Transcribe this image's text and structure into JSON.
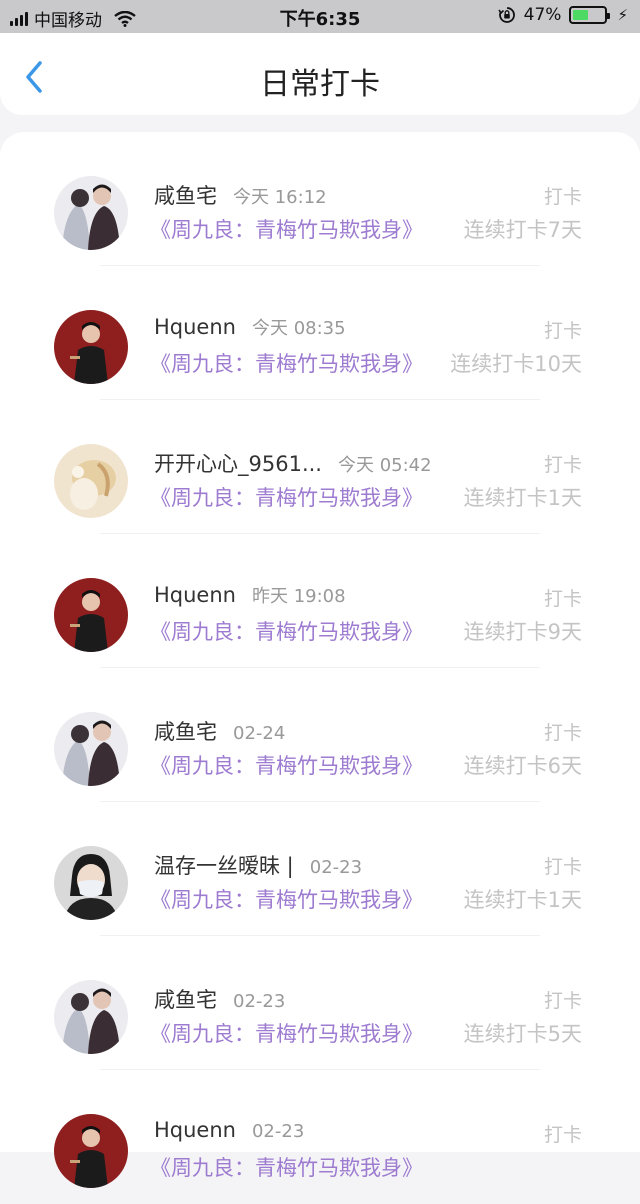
{
  "status_bar": {
    "carrier": "中国移动",
    "time": "下午6:35",
    "battery": "47%",
    "battery_level": 0.47
  },
  "nav": {
    "title": "日常打卡"
  },
  "entries": [
    {
      "name": "咸鱼宅",
      "time": "今天 16:12",
      "book": "《周九良：青梅竹马欺我身》",
      "label": "打卡",
      "streak": "连续打卡7天",
      "avatar": "avatar-couple"
    },
    {
      "name": "Hquenn",
      "time": "今天 08:35",
      "book": "《周九良：青梅竹马欺我身》",
      "label": "打卡",
      "streak": "连续打卡10天",
      "avatar": "avatar-red"
    },
    {
      "name": "开开心心_9561...",
      "time": "今天 05:42",
      "book": "《周九良：青梅竹马欺我身》",
      "label": "打卡",
      "streak": "连续打卡1天",
      "avatar": "avatar-beige"
    },
    {
      "name": "Hquenn",
      "time": "昨天 19:08",
      "book": "《周九良：青梅竹马欺我身》",
      "label": "打卡",
      "streak": "连续打卡9天",
      "avatar": "avatar-red"
    },
    {
      "name": "咸鱼宅",
      "time": "02-24",
      "book": "《周九良：青梅竹马欺我身》",
      "label": "打卡",
      "streak": "连续打卡6天",
      "avatar": "avatar-couple"
    },
    {
      "name": "温存一丝暧昧 |",
      "time": "02-23",
      "book": "《周九良：青梅竹马欺我身》",
      "label": "打卡",
      "streak": "连续打卡1天",
      "avatar": "avatar-mask"
    },
    {
      "name": "咸鱼宅",
      "time": "02-23",
      "book": "《周九良：青梅竹马欺我身》",
      "label": "打卡",
      "streak": "连续打卡5天",
      "avatar": "avatar-couple"
    },
    {
      "name": "Hquenn",
      "time": "02-23",
      "book": "《周九良：青梅竹马欺我身》",
      "label": "打卡",
      "streak": "",
      "avatar": "avatar-red"
    }
  ]
}
